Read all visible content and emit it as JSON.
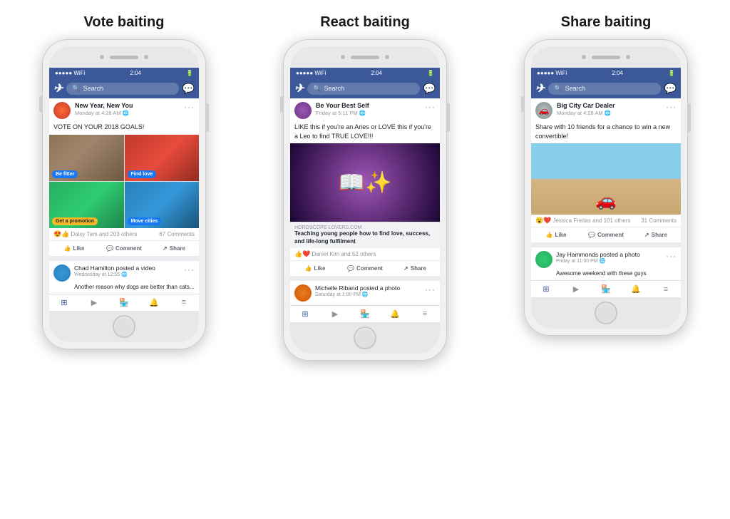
{
  "sections": [
    {
      "id": "vote-baiting",
      "title": "Vote baiting",
      "phone": {
        "statusBar": {
          "time": "2:04",
          "signal": "●●●●●",
          "wifi": "WiFi",
          "battery": "■■■"
        },
        "searchPlaceholder": "Search",
        "post": {
          "author": "New Year, New You",
          "time": "Monday at 4:28 AM",
          "privacy": "🌐",
          "text": "VOTE ON YOUR 2018 GOALS!",
          "imageLabels": [
            "Be fitter",
            "Find love",
            "Get a promotion",
            "Move cities"
          ],
          "reactions": "😍👍 Daisy Tam and 203 others",
          "comments": "67 Comments",
          "likeLabel": "Like",
          "commentLabel": "Comment",
          "shareLabel": "Share"
        },
        "secondaryPost": {
          "author": "Chad Hamilton",
          "action": "posted a video",
          "time": "Wednesday at 12:55",
          "privacy": "🌐",
          "text": "Another reason why dogs are better than cats..."
        }
      }
    },
    {
      "id": "react-baiting",
      "title": "React baiting",
      "phone": {
        "statusBar": {
          "time": "2:04",
          "signal": "●●●●●",
          "wifi": "WiFi",
          "battery": "■■■"
        },
        "searchPlaceholder": "Search",
        "post": {
          "author": "Be Your Best Self",
          "time": "Friday at 5:11 PM",
          "privacy": "🌐",
          "text": "LIKE this if you're an Aries or LOVE this if you're a Leo to find TRUE LOVE!!!",
          "linkDomain": "HOROSCOPE-LOVERS.COM",
          "linkTitle": "Teaching young people how to find love, success, and life-long fulfilment",
          "reactions": "👍❤️ Daniel Kim and 52 others",
          "likeLabel": "Like",
          "commentLabel": "Comment",
          "shareLabel": "Share"
        },
        "secondaryPost": {
          "author": "Michelle Riband",
          "action": "posted a photo",
          "time": "Saturday at 1:00 PM",
          "privacy": "🌐",
          "text": ""
        }
      }
    },
    {
      "id": "share-baiting",
      "title": "Share baiting",
      "phone": {
        "statusBar": {
          "time": "2:04",
          "signal": "●●●●●",
          "wifi": "WiFi",
          "battery": "■■■"
        },
        "searchPlaceholder": "Search",
        "post": {
          "author": "Big City Car Dealer",
          "time": "Monday at 4:28 AM",
          "privacy": "🌐",
          "text": "Share with 10 friends for a chance to win a new convertible!",
          "reactions": "😮❤️ Jessica Freitas and 101 others",
          "comments": "31 Comments",
          "likeLabel": "Like",
          "commentLabel": "Comment",
          "shareLabel": "Share"
        },
        "secondaryPost": {
          "author": "Jay Hammonds",
          "action": "posted a photo",
          "time": "Friday at 11:00 PM",
          "privacy": "🌐",
          "text": "Awesome weekend with these guys"
        }
      }
    }
  ]
}
